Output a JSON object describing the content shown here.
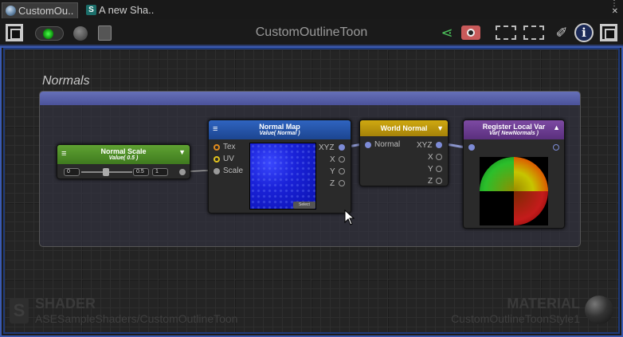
{
  "tabs": [
    {
      "label": "CustomOu..",
      "icon": "unity-globe-icon"
    },
    {
      "label": "A new Sha..",
      "icon": "shader-icon"
    }
  ],
  "window_controls": {
    "menu": "⋮",
    "close": "✕"
  },
  "toolbar": {
    "title": "CustomOutlineToon",
    "left_icons": [
      "maximize-icon",
      "live-mode-icon",
      "circle-icon",
      "console-icon"
    ],
    "right_icons": [
      "share-icon",
      "screenshot-icon",
      "focus-icon",
      "fit-icon",
      "clean-brush-icon",
      "info-icon",
      "maximize-icon"
    ]
  },
  "group": {
    "title": "Normals",
    "color": "#5a62aa"
  },
  "nodes": {
    "normal_scale": {
      "title": "Normal Scale",
      "subtitle": "Value( 0.5 )",
      "color": "#4e8a2a",
      "min": "0",
      "value": "0.5",
      "max": "1"
    },
    "normal_map": {
      "title": "Normal Map",
      "subtitle": "Value( Normal )",
      "color": "#1f4fa0",
      "inputs": [
        "Tex",
        "UV",
        "Scale"
      ],
      "outputs": [
        "XYZ",
        "X",
        "Y",
        "Z"
      ],
      "select_label": "Select"
    },
    "world_normal": {
      "title": "World Normal",
      "color": "#b8960a",
      "inputs": [
        "Normal"
      ],
      "outputs": [
        "XYZ",
        "X",
        "Y",
        "Z"
      ]
    },
    "register_local_var": {
      "title": "Register Local Var",
      "subtitle": "Var( NewNormals )",
      "color": "#6a3c8a"
    }
  },
  "watermark": {
    "shader_label": "SHADER",
    "shader_path": "ASESampleShaders/CustomOutlineToon",
    "material_label": "MATERIAL",
    "material_name": "CustomOutlineToonStyle1"
  }
}
